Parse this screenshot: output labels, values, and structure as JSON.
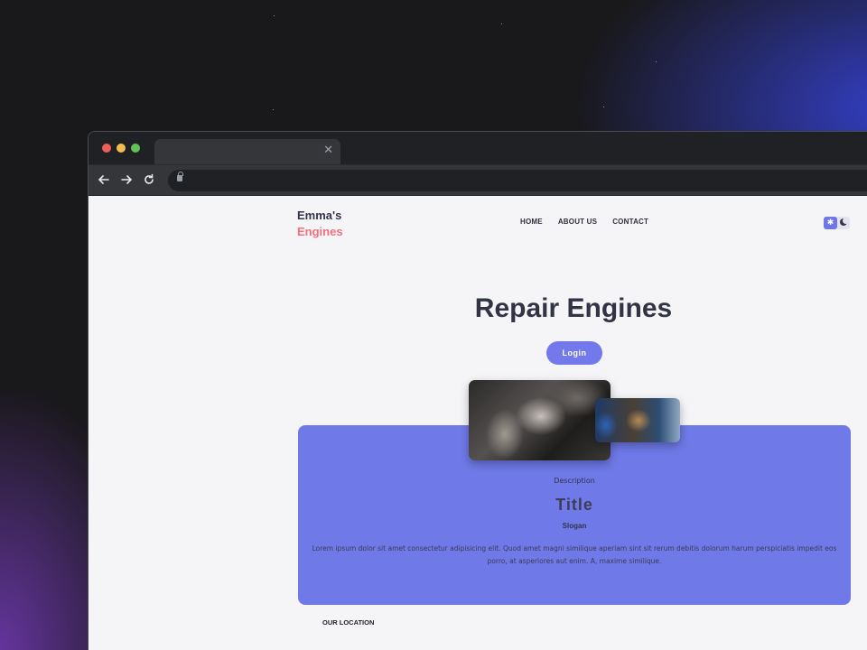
{
  "browser": {
    "tab_close": "✕",
    "back_icon": "arrow-left-icon",
    "forward_icon": "arrow-right-icon",
    "reload_icon": "reload-icon",
    "lock_icon": "lock-icon"
  },
  "site": {
    "logo_line1": "Emma's",
    "logo_line2": "Engines",
    "nav": [
      "HOME",
      "ABOUT US",
      "CONTACT"
    ],
    "theme_toggle": {
      "light_icon": "sun-icon",
      "dark_icon": "moon-icon",
      "active": "light"
    },
    "hero_title": "Repair Engines",
    "login_label": "Login",
    "images": [
      "engine-repair-image",
      "engine-parts-image"
    ],
    "card": {
      "description": "Description",
      "title": "Title",
      "slogan": "Slogan",
      "body": "Lorem ipsum dolor sit amet consectetur adipisicing elit. Quod amet magni similique aperiam sint sit rerum debitis dolorum harum perspiciatis impedit eos porro, at asperiores aut enim. A, maxime similique."
    },
    "location_label": "OUR LOCATION"
  },
  "colors": {
    "accent": "#7379eb",
    "card_bg": "#6f7ae8",
    "logo_accent": "#f2707a",
    "text_dark": "#333346"
  }
}
